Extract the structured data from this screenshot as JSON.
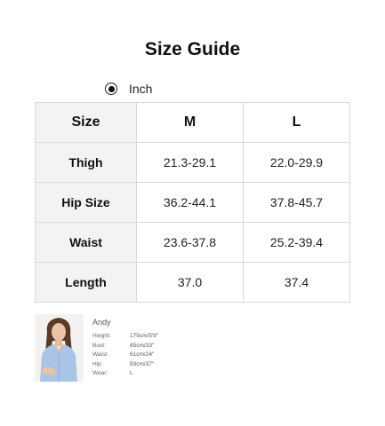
{
  "title": "Size Guide",
  "unit": {
    "label": "Inch",
    "selected": true
  },
  "table": {
    "header": {
      "label": "Size",
      "sizes": [
        "M",
        "L"
      ]
    },
    "rows": [
      {
        "label": "Thigh",
        "values": [
          "21.3-29.1",
          "22.0-29.9"
        ]
      },
      {
        "label": "Hip Size",
        "values": [
          "36.2-44.1",
          "37.8-45.7"
        ]
      },
      {
        "label": "Waist",
        "values": [
          "23.6-37.8",
          "25.2-39.4"
        ]
      },
      {
        "label": "Length",
        "values": [
          "37.0",
          "37.4"
        ]
      }
    ]
  },
  "model": {
    "name": "Andy",
    "stats": [
      {
        "label": "Height:",
        "value": "175cm/5'9\""
      },
      {
        "label": "Bust:",
        "value": "85cm/33\""
      },
      {
        "label": "Waist:",
        "value": "61cm/24\""
      },
      {
        "label": "Hip:",
        "value": "93cm/37\""
      },
      {
        "label": "Wear:",
        "value": "L"
      }
    ]
  },
  "colors": {
    "header_bg": "#f3f3f3",
    "border": "#d9d9d9",
    "shirt": "#a9c4e6"
  }
}
